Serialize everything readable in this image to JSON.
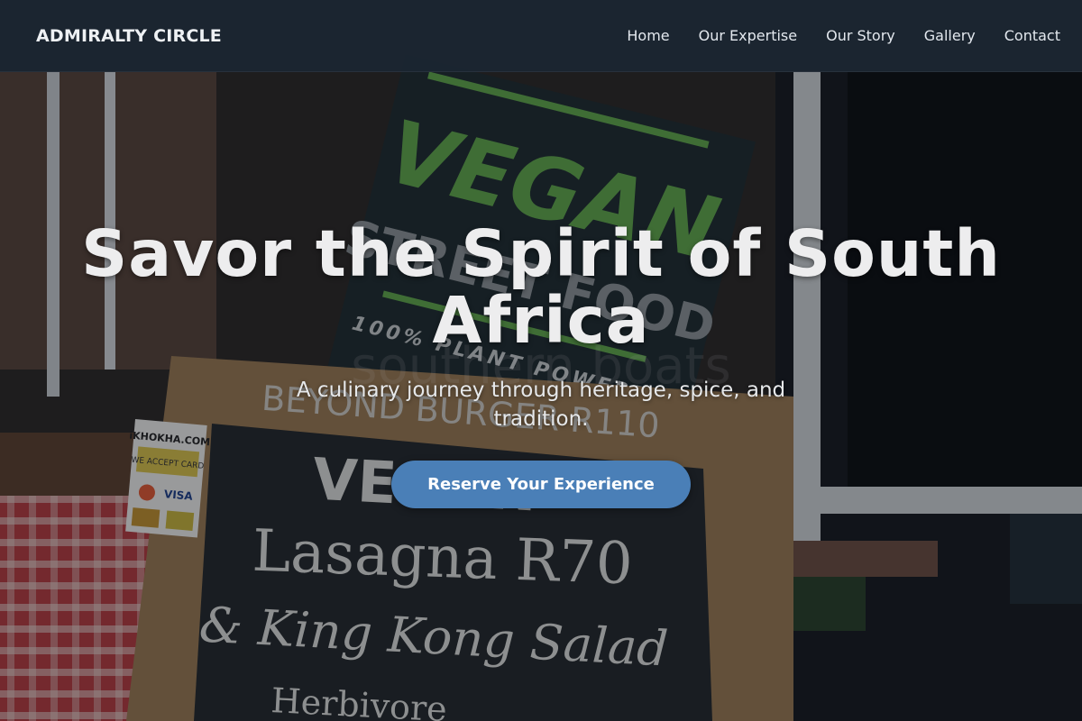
{
  "nav": {
    "brand": "ADMIRALTY CIRCLE",
    "links": [
      "Home",
      "Our Expertise",
      "Our Story",
      "Gallery",
      "Contact"
    ]
  },
  "hero": {
    "title": "Savor the Spirit of South Africa",
    "subtitle": "A culinary journey through heritage, spice, and tradition.",
    "cta_label": "Reserve Your Experience",
    "photo_text": {
      "sign_top": "VEGAN",
      "sign_sub": "STREET FOOD",
      "sign_tag": "100% PLANT POWERED",
      "board_header": "BEYOND BURGER R110",
      "board_line1": "VEGAN",
      "board_line2": "Lasagna R70",
      "board_line3": "& King Kong Salad",
      "board_line4": "Herbivore",
      "watermark": "southern boats",
      "card_brand": "iKHOKHA.COM",
      "card_accept": "WE ACCEPT CARD",
      "card_visa": "VISA"
    }
  },
  "colors": {
    "nav_bg": "#1b2632",
    "cta": "#4a7fb7",
    "sign_green": "#5fa84a"
  }
}
